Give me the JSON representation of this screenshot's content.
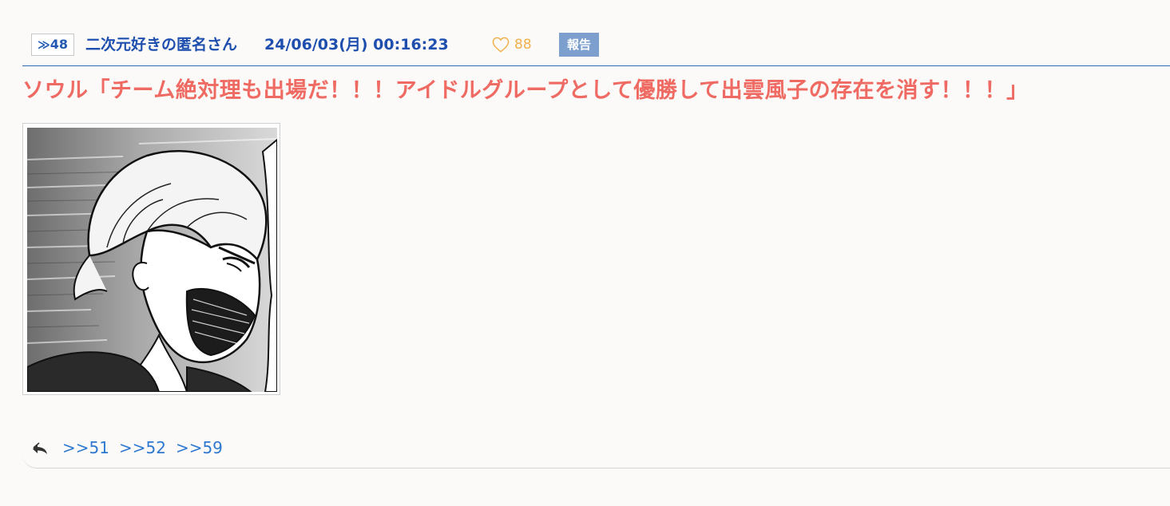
{
  "post": {
    "res_number": "48",
    "author": "二次元好きの匿名さん",
    "date": "24/06/03(月) 00:16:23",
    "like_count": "88",
    "report_label": "報告",
    "title": "ソウル「チーム絶対理も出場だ！！！アイドルグループとして優勝して出雲風子の存在を消す！！！」",
    "image": {
      "description": "manga panel of a shouting character"
    },
    "replies": [
      ">>51",
      ">>52",
      ">>59"
    ]
  },
  "icons": {
    "res_arrow": "double-chevron-right-icon",
    "like": "heart-outline-icon",
    "reply": "reply-all-icon"
  },
  "colors": {
    "header_text": "#1f4fae",
    "title_text": "#ef6a62",
    "like_text": "#f0b04a",
    "report_bg": "#7c9fce",
    "reply_link": "#2d78d0"
  }
}
